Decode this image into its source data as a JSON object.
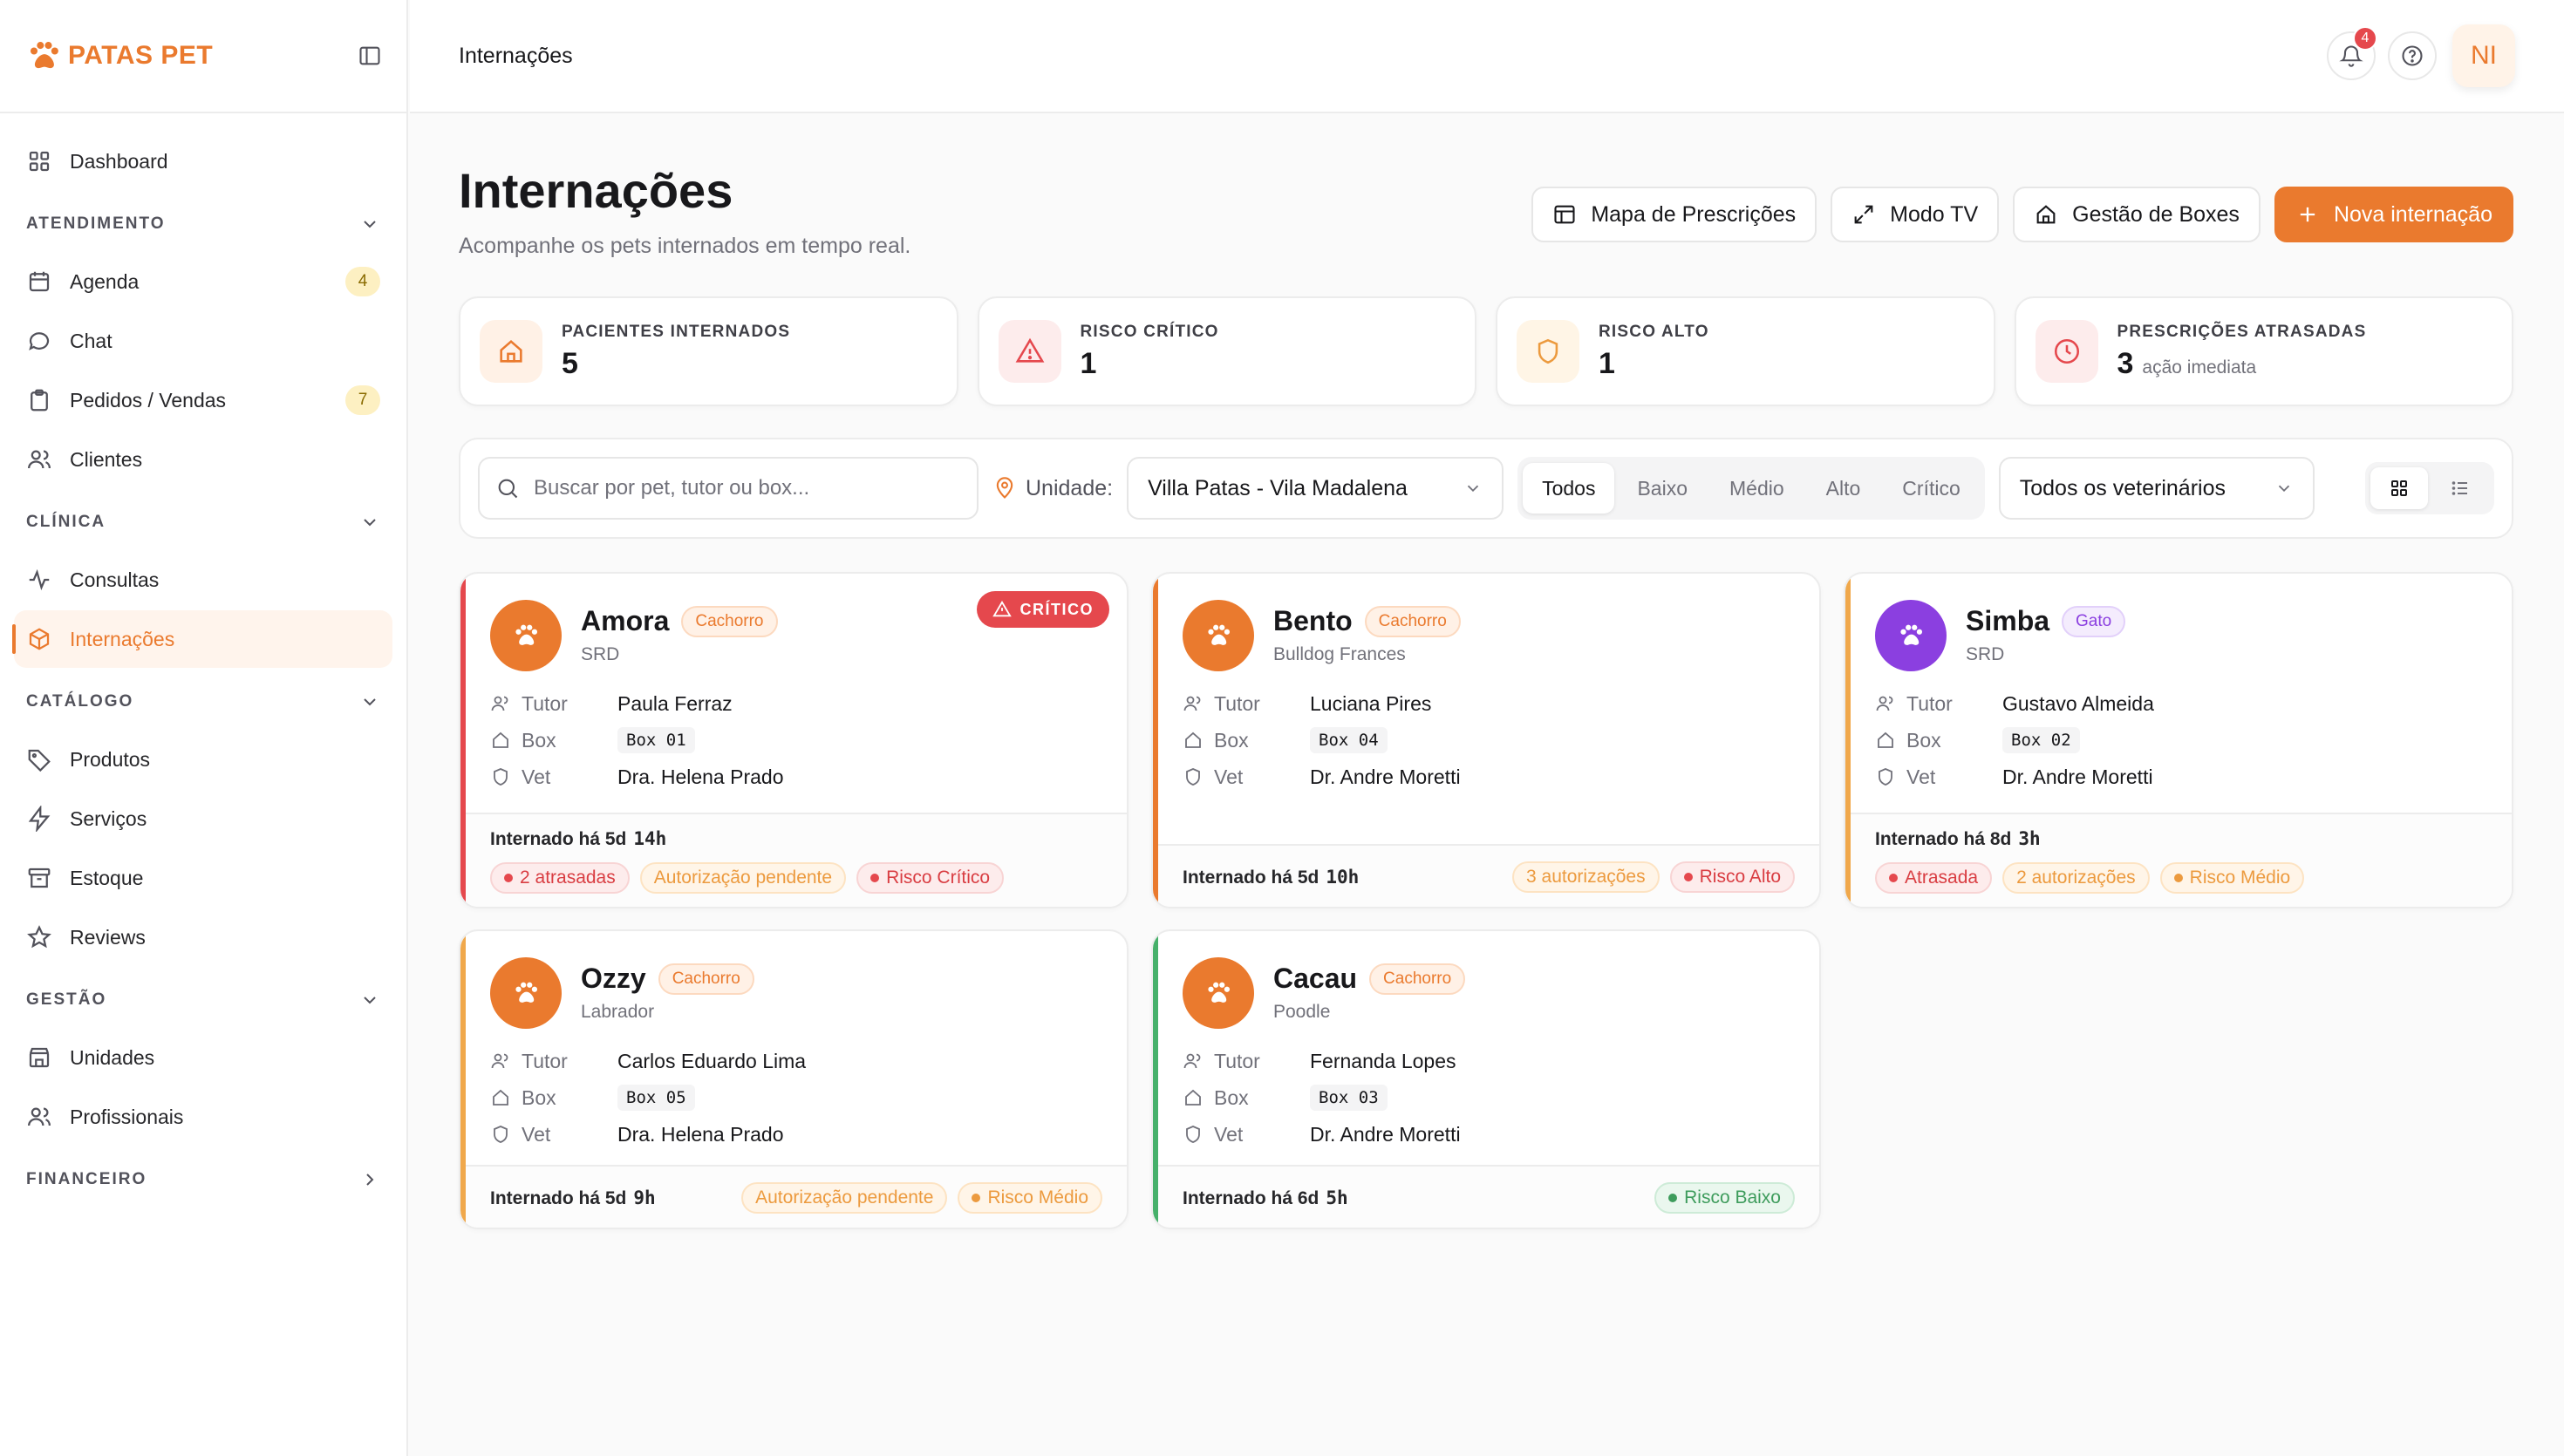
{
  "brand": {
    "name": "PATAS PET",
    "accent": "#ea7a2e"
  },
  "sidebar": {
    "dashboard": "Dashboard",
    "sections": [
      {
        "title": "ATENDIMENTO",
        "items": [
          {
            "label": "Agenda",
            "badge": "4",
            "icon": "calendar-icon"
          },
          {
            "label": "Chat",
            "badge": "",
            "icon": "chat-icon"
          },
          {
            "label": "Pedidos / Vendas",
            "badge": "7",
            "icon": "clipboard-icon"
          },
          {
            "label": "Clientes",
            "badge": "",
            "icon": "users-icon"
          }
        ]
      },
      {
        "title": "CLÍNICA",
        "items": [
          {
            "label": "Consultas",
            "icon": "activity-icon"
          },
          {
            "label": "Internações",
            "icon": "box-icon",
            "active": true
          }
        ]
      },
      {
        "title": "CATÁLOGO",
        "items": [
          {
            "label": "Produtos",
            "icon": "tag-icon"
          },
          {
            "label": "Serviços",
            "icon": "zap-icon"
          },
          {
            "label": "Estoque",
            "icon": "archive-icon"
          },
          {
            "label": "Reviews",
            "icon": "star-icon"
          }
        ]
      },
      {
        "title": "GESTÃO",
        "items": [
          {
            "label": "Unidades",
            "icon": "store-icon"
          },
          {
            "label": "Profissionais",
            "icon": "users-icon"
          }
        ]
      },
      {
        "title": "FINANCEIRO",
        "items": []
      }
    ]
  },
  "topbar": {
    "title": "Internações",
    "notifications": "4",
    "avatar": "NI"
  },
  "page": {
    "title": "Internações",
    "subtitle": "Acompanhe os pets internados em tempo real.",
    "actions": {
      "map": "Mapa de Prescrições",
      "tv": "Modo TV",
      "boxes": "Gestão de Boxes",
      "new": "Nova internação"
    }
  },
  "stats": [
    {
      "label": "PACIENTES INTERNADOS",
      "value": "5",
      "note": ""
    },
    {
      "label": "RISCO CRÍTICO",
      "value": "1",
      "note": ""
    },
    {
      "label": "RISCO ALTO",
      "value": "1",
      "note": ""
    },
    {
      "label": "PRESCRIÇÕES ATRASADAS",
      "value": "3",
      "note": "ação imediata"
    }
  ],
  "filters": {
    "search_placeholder": "Buscar por pet, tutor ou box...",
    "unit_label": "Unidade:",
    "unit_value": "Villa Patas - Vila Madalena",
    "risk_tabs": [
      "Todos",
      "Baixo",
      "Médio",
      "Alto",
      "Crítico"
    ],
    "vet_value": "Todos os veterinários"
  },
  "labels": {
    "tutor": "Tutor",
    "box": "Box",
    "vet": "Vet",
    "since": "Internado há"
  },
  "patients": [
    {
      "name": "Amora",
      "species": "Cachorro",
      "breed": "SRD",
      "tutor": "Paula Ferraz",
      "box": "Box 01",
      "vet": "Dra. Helena Prado",
      "since_d": "5d",
      "since_h": "14h",
      "critical_badge": "CRÍTICO",
      "tags": [
        {
          "text": "2 atrasadas",
          "kind": "red",
          "dot": true
        },
        {
          "text": "Autorização pendente",
          "kind": "orange",
          "dot": false
        },
        {
          "text": "Risco Crítico",
          "kind": "red",
          "dot": true
        }
      ]
    },
    {
      "name": "Bento",
      "species": "Cachorro",
      "breed": "Bulldog Frances",
      "tutor": "Luciana Pires",
      "box": "Box 04",
      "vet": "Dr. Andre Moretti",
      "since_d": "5d",
      "since_h": "10h",
      "tags": [
        {
          "text": "3 autorizações",
          "kind": "orange",
          "dot": false
        },
        {
          "text": "Risco Alto",
          "kind": "red",
          "dot": true
        }
      ]
    },
    {
      "name": "Simba",
      "species": "Gato",
      "breed": "SRD",
      "tutor": "Gustavo Almeida",
      "box": "Box 02",
      "vet": "Dr. Andre Moretti",
      "since_d": "8d",
      "since_h": "3h",
      "tags": [
        {
          "text": "Atrasada",
          "kind": "red",
          "dot": true
        },
        {
          "text": "2 autorizações",
          "kind": "orange",
          "dot": false
        },
        {
          "text": "Risco Médio",
          "kind": "orange",
          "dot": true
        }
      ]
    },
    {
      "name": "Ozzy",
      "species": "Cachorro",
      "breed": "Labrador",
      "tutor": "Carlos Eduardo Lima",
      "box": "Box 05",
      "vet": "Dra. Helena Prado",
      "since_d": "5d",
      "since_h": "9h",
      "tags": [
        {
          "text": "Autorização pendente",
          "kind": "orange",
          "dot": false
        },
        {
          "text": "Risco Médio",
          "kind": "orange",
          "dot": true
        }
      ]
    },
    {
      "name": "Cacau",
      "species": "Cachorro",
      "breed": "Poodle",
      "tutor": "Fernanda Lopes",
      "box": "Box 03",
      "vet": "Dr. Andre Moretti",
      "since_d": "6d",
      "since_h": "5h",
      "tags": [
        {
          "text": "Risco Baixo",
          "kind": "green",
          "dot": true
        }
      ]
    }
  ],
  "colors": {
    "critical": "#e5484d",
    "high": "#ec9a3e",
    "medium": "#f0a84b",
    "low": "#46b06a",
    "cat_purple": "#8b3fe0"
  }
}
